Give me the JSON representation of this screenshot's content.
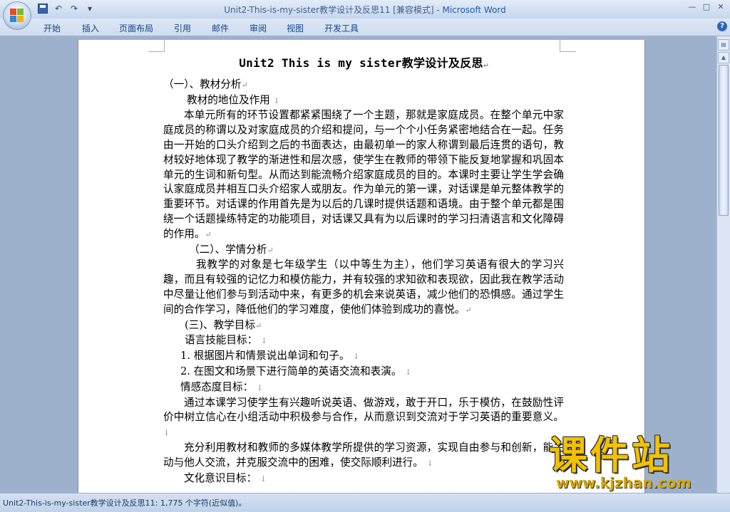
{
  "window": {
    "doc_name": "Unit2-This-is-my-sister教学设计及反思11 [兼容模式]",
    "separator": " - ",
    "app_name": "Microsoft Word",
    "controls": [
      "—",
      "□",
      "✕"
    ]
  },
  "quick_access": {
    "undo": "↶",
    "redo": "↷",
    "more": "▾"
  },
  "ribbon": {
    "tabs": [
      "开始",
      "插入",
      "页面布局",
      "引用",
      "邮件",
      "审阅",
      "视图",
      "开发工具"
    ],
    "help": "?"
  },
  "document": {
    "title": "Unit2 This is my sister教学设计及反思",
    "paragraphs": [
      {
        "text": "（一）、教材分析",
        "mark": "↵"
      },
      {
        "text": "教材的地位及作用 ",
        "mark": "↓"
      },
      {
        "text": "本单元所有的环节设置都紧紧围绕了一个主题，那就是家庭成员。在整个单元中家庭成员的称谓以及对家庭成员的介绍和提问，与一个个小任务紧密地结合在一起。任务由一开始的口头介绍到之后的书面表达，由最初单一的家人称谓到最后连贯的语句，教材较好地体现了教学的渐进性和层次感，使学生在教师的带领下能反复地掌握和巩固本单元的生词和新句型。从而达到能流畅介绍家庭成员的目的。本课时主要让学生学会确认家庭成员并相互口头介绍家人或朋友。作为单元的第一课，对话课是单元整体教学的重要环节。对话课的作用首先是为以后的几课时提供话题和语境。由于整个单元都是围绕一个话题操练特定的功能项目，对话课又具有为以后课时的学习扫清语言和文化障碍的作用。",
        "mark": "↵"
      },
      {
        "text": "（二）、学情分析",
        "mark": "↵"
      },
      {
        "text": "我教学的对象是七年级学生（以中等生为主），他们学习英语有很大的学习兴趣，而且有较强的记忆力和模仿能力，并有较强的求知欲和表现欲，因此我在教学活动中尽量让他们参与到活动中来，有更多的机会来说英语，减少他们的恐惧感。通过学生间的合作学习，降低他们的学习难度，使他们体验到成功的喜悦。",
        "mark": "↵"
      },
      {
        "text": "(三)、教学目标",
        "mark": "↵"
      },
      {
        "text": "语言技能目标： ",
        "mark": "↓"
      },
      {
        "text": "1. 根据图片和情景说出单词和句子。 ",
        "mark": "↓"
      },
      {
        "text": "2. 在图文和场景下进行简单的英语交流和表演。 ",
        "mark": "↓"
      },
      {
        "text": "情感态度目标： ",
        "mark": "↓"
      },
      {
        "text": "通过本课学习使学生有兴趣听说英语、做游戏，敢于开口，乐于模仿，在鼓励性评价中树立信心在小组活动中积极参与合作，从而意识到交流对于学习英语的重要意义。 ",
        "mark": "↓"
      },
      {
        "text": "充分利用教材和教师的多媒体教学所提供的学习资源，实现自由参与和创新，能主动与他人交流，并克服交流中的困难，使交际顺利进行。 ",
        "mark": "↓"
      },
      {
        "text": "文化意识目标： ",
        "mark": "↓"
      }
    ]
  },
  "statusbar": {
    "text": "Unit2-This-is-my-sister教学设计及反思11: 1,775 个字符(近似值)。"
  },
  "watermark": {
    "big": "课件站",
    "url": "www.kjzhan.com"
  }
}
